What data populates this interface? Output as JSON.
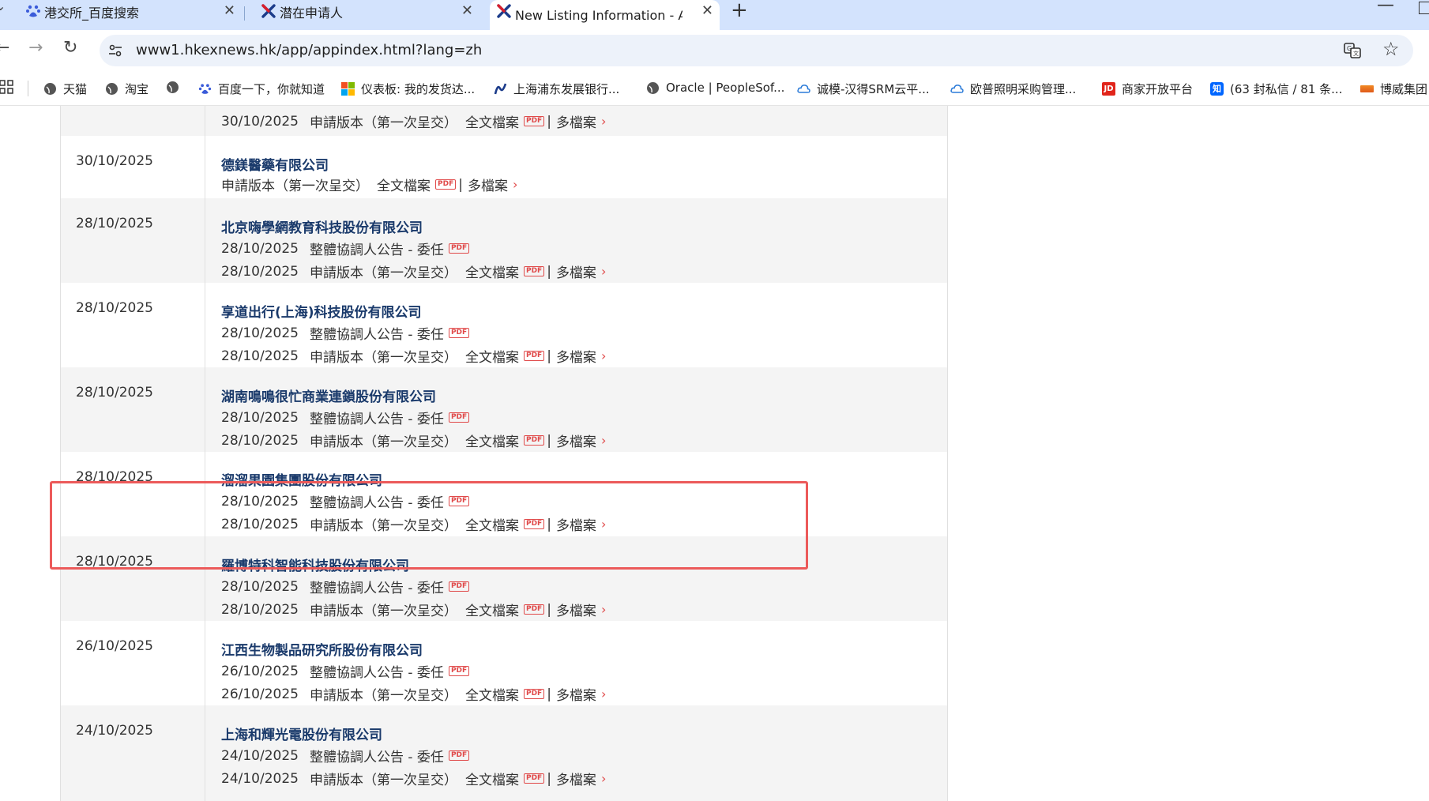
{
  "browser": {
    "tabs": [
      {
        "title": "港交所_百度搜索",
        "icon": "baidu-paw-icon",
        "active": false
      },
      {
        "title": "潜在申请人",
        "icon": "hkex-logo-icon",
        "active": false
      },
      {
        "title": "New Listing Information - AP",
        "icon": "hkex-logo-icon",
        "active": true
      }
    ],
    "url": "www1.hkexnews.hk/app/appindex.html?lang=zh",
    "bookmarks": [
      {
        "label": "天猫",
        "icon": "globe-icon"
      },
      {
        "label": "淘宝",
        "icon": "globe-icon"
      },
      {
        "label": "",
        "icon": "globe-icon"
      },
      {
        "label": "百度一下，你就知道",
        "icon": "baidu-paw-icon"
      },
      {
        "label": "仪表板: 我的发货达...",
        "icon": "windows-logo-icon"
      },
      {
        "label": "上海浦东发展银行...",
        "icon": "spdb-logo-icon"
      },
      {
        "label": "Oracle | PeopleSof...",
        "icon": "globe-icon"
      },
      {
        "label": "诚模-汉得SRM云平...",
        "icon": "cloud-icon"
      },
      {
        "label": "欧普照明采购管理...",
        "icon": "cloud-icon"
      },
      {
        "label": "商家开放平台",
        "icon": "jd-logo-icon"
      },
      {
        "label": "(63 封私信 / 81 条...",
        "icon": "zhihu-logo-icon"
      },
      {
        "label": "博威集团",
        "icon": "boway-logo-icon"
      }
    ]
  },
  "labels": {
    "announcement": "整體協調人公告 - 委任",
    "application": "申請版本（第一次呈交）",
    "full_doc": "全文檔案",
    "multi_doc": "多檔案",
    "pdf": "PDF",
    "pipe": "|",
    "chevron": "›"
  },
  "listings": [
    {
      "date": "",
      "company": "",
      "docs": [
        {
          "date": "30/10/2025",
          "type": "application"
        }
      ]
    },
    {
      "date": "30/10/2025",
      "company": "德鎂醫藥有限公司",
      "docs": [
        {
          "date": "",
          "type": "application"
        }
      ]
    },
    {
      "date": "28/10/2025",
      "company": "北京嗨學網教育科技股份有限公司",
      "docs": [
        {
          "date": "28/10/2025",
          "type": "announcement"
        },
        {
          "date": "28/10/2025",
          "type": "application"
        }
      ]
    },
    {
      "date": "28/10/2025",
      "company": "享道出行(上海)科技股份有限公司",
      "docs": [
        {
          "date": "28/10/2025",
          "type": "announcement"
        },
        {
          "date": "28/10/2025",
          "type": "application"
        }
      ]
    },
    {
      "date": "28/10/2025",
      "company": "湖南鳴鳴很忙商業連鎖股份有限公司",
      "highlighted": true,
      "docs": [
        {
          "date": "28/10/2025",
          "type": "announcement"
        },
        {
          "date": "28/10/2025",
          "type": "application"
        }
      ]
    },
    {
      "date": "28/10/2025",
      "company": "溜溜果園集團股份有限公司",
      "docs": [
        {
          "date": "28/10/2025",
          "type": "announcement"
        },
        {
          "date": "28/10/2025",
          "type": "application"
        }
      ]
    },
    {
      "date": "28/10/2025",
      "company": "羅博特科智能科技股份有限公司",
      "docs": [
        {
          "date": "28/10/2025",
          "type": "announcement"
        },
        {
          "date": "28/10/2025",
          "type": "application"
        }
      ]
    },
    {
      "date": "26/10/2025",
      "company": "江西生物製品研究所股份有限公司",
      "docs": [
        {
          "date": "26/10/2025",
          "type": "announcement"
        },
        {
          "date": "26/10/2025",
          "type": "application"
        }
      ]
    },
    {
      "date": "24/10/2025",
      "company": "上海和輝光電股份有限公司",
      "docs": [
        {
          "date": "24/10/2025",
          "type": "announcement"
        },
        {
          "date": "24/10/2025",
          "type": "application"
        }
      ]
    }
  ],
  "colors": {
    "tabstrip_bg": "#d3e3fd",
    "company_link": "#1a3a6b",
    "pdf_red": "#e04a4a",
    "highlight_border": "#ec5a5a",
    "row_alt_bg": "#f4f4f4"
  }
}
